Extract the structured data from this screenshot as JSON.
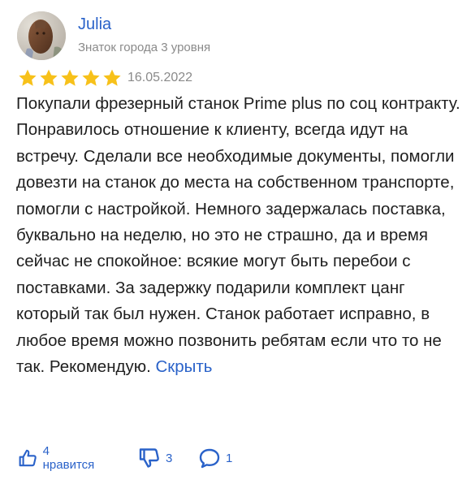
{
  "author": {
    "name": "Julia",
    "level": "Знаток города 3 уровня"
  },
  "rating": {
    "stars": 5,
    "max": 5,
    "color": "#f7c11a"
  },
  "review": {
    "date": "16.05.2022",
    "text": "Покупали фрезерный станок Prime plus по соц контракту. Понравилось отношение к клиенту, всегда идут на встречу. Сделали все необходимые документы, помогли довезти на станок до места на собственном транспорте, помогли с настройкой. Немного задержалась поставка, буквально на неделю, но это не страшно, да и время сейчас не спокойное: всякие могут быть перебои с поставками. За задержку подарили комплект цанг который так был нужен. Станок работает исправно, в любое время можно позвонить ребятам если что то не так. Рекомендую.",
    "hide_label": "Скрыть"
  },
  "actions": {
    "like_label": "4 нравится",
    "dislike_count": "3",
    "comments_count": "1"
  },
  "colors": {
    "link": "#2a62c9",
    "muted": "#8a8a8a",
    "text": "#1f1f1f"
  },
  "icons": [
    "thumbs-up-icon",
    "thumbs-down-icon",
    "comment-icon",
    "star-icon"
  ]
}
